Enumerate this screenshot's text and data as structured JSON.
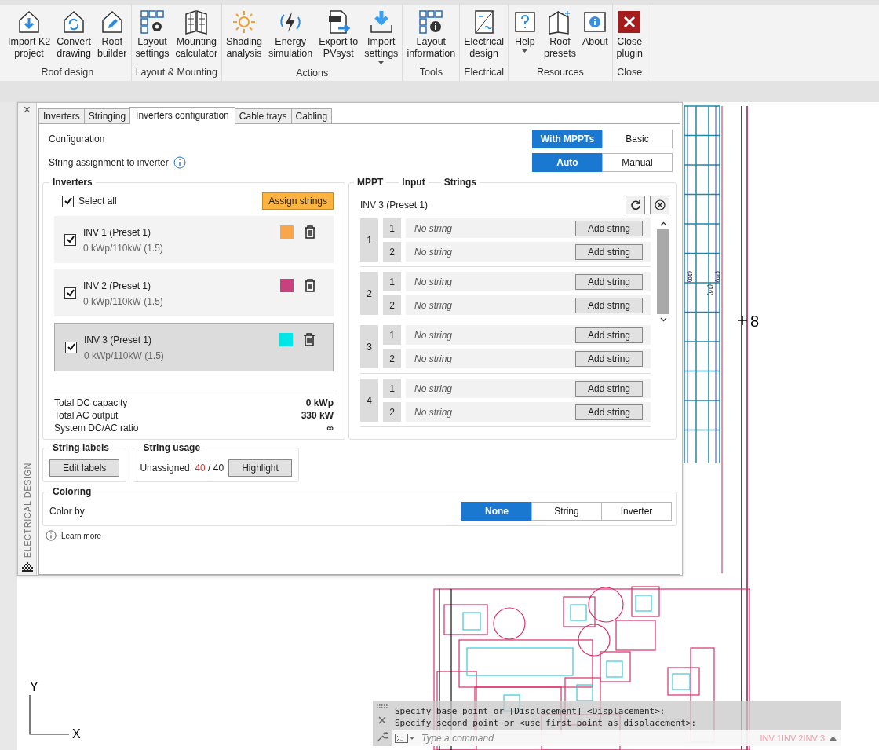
{
  "ribbon": {
    "groups": [
      {
        "label": "Roof design",
        "buttons": [
          {
            "lines": [
              "Import K2",
              "project"
            ],
            "dropdown": false
          },
          {
            "lines": [
              "Convert",
              "drawing"
            ],
            "dropdown": false
          },
          {
            "lines": [
              "Roof",
              "builder"
            ],
            "dropdown": false
          }
        ]
      },
      {
        "label": "Layout & Mounting",
        "buttons": [
          {
            "lines": [
              "Layout",
              "settings"
            ],
            "dropdown": false
          },
          {
            "lines": [
              "Mounting",
              "calculator"
            ],
            "dropdown": false
          }
        ]
      },
      {
        "label": "Actions",
        "buttons": [
          {
            "lines": [
              "Shading",
              "analysis"
            ],
            "dropdown": false
          },
          {
            "lines": [
              "Energy",
              "simulation"
            ],
            "dropdown": false
          },
          {
            "lines": [
              "Export to",
              "PVsyst"
            ],
            "dropdown": false
          },
          {
            "lines": [
              "Import",
              "settings"
            ],
            "dropdown": true
          }
        ]
      },
      {
        "label": "Tools",
        "buttons": [
          {
            "lines": [
              "Layout",
              "information"
            ],
            "dropdown": false
          }
        ]
      },
      {
        "label": "Electrical",
        "buttons": [
          {
            "lines": [
              "Electrical",
              "design"
            ],
            "dropdown": false
          }
        ]
      },
      {
        "label": "Resources",
        "buttons": [
          {
            "lines": [
              "Help"
            ],
            "dropdown": true
          },
          {
            "lines": [
              "Roof",
              "presets"
            ],
            "dropdown": false
          },
          {
            "lines": [
              "About"
            ],
            "dropdown": false
          }
        ]
      },
      {
        "label": "Close",
        "buttons": [
          {
            "lines": [
              "Close",
              "plugin"
            ],
            "dropdown": false
          }
        ]
      }
    ]
  },
  "panel": {
    "close": "×",
    "sidebar_title": "ELECTRICAL DESIGN",
    "tabs": [
      {
        "label": "Inverters",
        "selected": false
      },
      {
        "label": "Stringing",
        "selected": false
      },
      {
        "label": "Inverters configuration",
        "selected": true
      },
      {
        "label": "Cable trays",
        "selected": false
      },
      {
        "label": "Cabling",
        "selected": false
      }
    ],
    "configuration": {
      "label": "Configuration",
      "options": [
        {
          "label": "With MPPTs",
          "selected": true
        },
        {
          "label": "Basic",
          "selected": false
        }
      ]
    },
    "assignment": {
      "label": "String assignment to inverter",
      "options": [
        {
          "label": "Auto",
          "selected": true
        },
        {
          "label": "Manual",
          "selected": false
        }
      ]
    },
    "inverters": {
      "title": "Inverters",
      "select_all": {
        "label": "Select all",
        "checked": true
      },
      "assign_button": "Assign strings",
      "items": [
        {
          "name": "INV 1 (Preset 1)",
          "capacity": "0 kWp/110kW (1.5)",
          "checked": true,
          "color": "#f9a64b",
          "selected": false
        },
        {
          "name": "INV 2 (Preset 1)",
          "capacity": "0 kWp/110kW (1.5)",
          "checked": true,
          "color": "#c8417f",
          "selected": false
        },
        {
          "name": "INV 3 (Preset 1)",
          "capacity": "0 kWp/110kW (1.5)",
          "checked": true,
          "color": "#00e5e5",
          "selected": true
        }
      ],
      "totals": [
        {
          "label": "Total DC capacity",
          "value": "0 kWp"
        },
        {
          "label": "Total AC output",
          "value": "330 kW"
        },
        {
          "label": "System DC/AC ratio",
          "value": "∞"
        }
      ]
    },
    "mppt": {
      "headers": [
        "MPPT",
        "Input",
        "Strings"
      ],
      "inverter": "INV 3 (Preset 1)",
      "mppts": [
        {
          "number": "1",
          "inputs": [
            {
              "number": "1",
              "string": "No string",
              "button": "Add string"
            },
            {
              "number": "2",
              "string": "No string",
              "button": "Add string"
            }
          ]
        },
        {
          "number": "2",
          "inputs": [
            {
              "number": "1",
              "string": "No string",
              "button": "Add string"
            },
            {
              "number": "2",
              "string": "No string",
              "button": "Add string"
            }
          ]
        },
        {
          "number": "3",
          "inputs": [
            {
              "number": "1",
              "string": "No string",
              "button": "Add string"
            },
            {
              "number": "2",
              "string": "No string",
              "button": "Add string"
            }
          ]
        },
        {
          "number": "4",
          "inputs": [
            {
              "number": "1",
              "string": "No string",
              "button": "Add string"
            },
            {
              "number": "2",
              "string": "No string",
              "button": "Add string"
            }
          ]
        }
      ]
    },
    "string_labels": {
      "title": "String labels",
      "button": "Edit labels"
    },
    "string_usage": {
      "title": "String usage",
      "label": "Unassigned:",
      "count": "40",
      "total": "/ 40",
      "button": "Highlight"
    },
    "coloring": {
      "title": "Coloring",
      "label": "Color by",
      "options": [
        {
          "label": "None",
          "selected": true
        },
        {
          "label": "String",
          "selected": false
        },
        {
          "label": "Inverter",
          "selected": false
        }
      ]
    },
    "footer": {
      "link": "Learn more"
    }
  },
  "cad": {
    "marker": "8",
    "labels": [
      "(16)",
      "(16)",
      "(16)"
    ],
    "axes": [
      "Y",
      "X"
    ]
  },
  "command_line": {
    "history": [
      "Specify base point or [Displacement] <Displacement>:",
      "Specify second point or <use first point as displacement>:"
    ],
    "placeholder": "Type a command",
    "legend": [
      "INV 1",
      "INV 2",
      "INV 3"
    ]
  }
}
